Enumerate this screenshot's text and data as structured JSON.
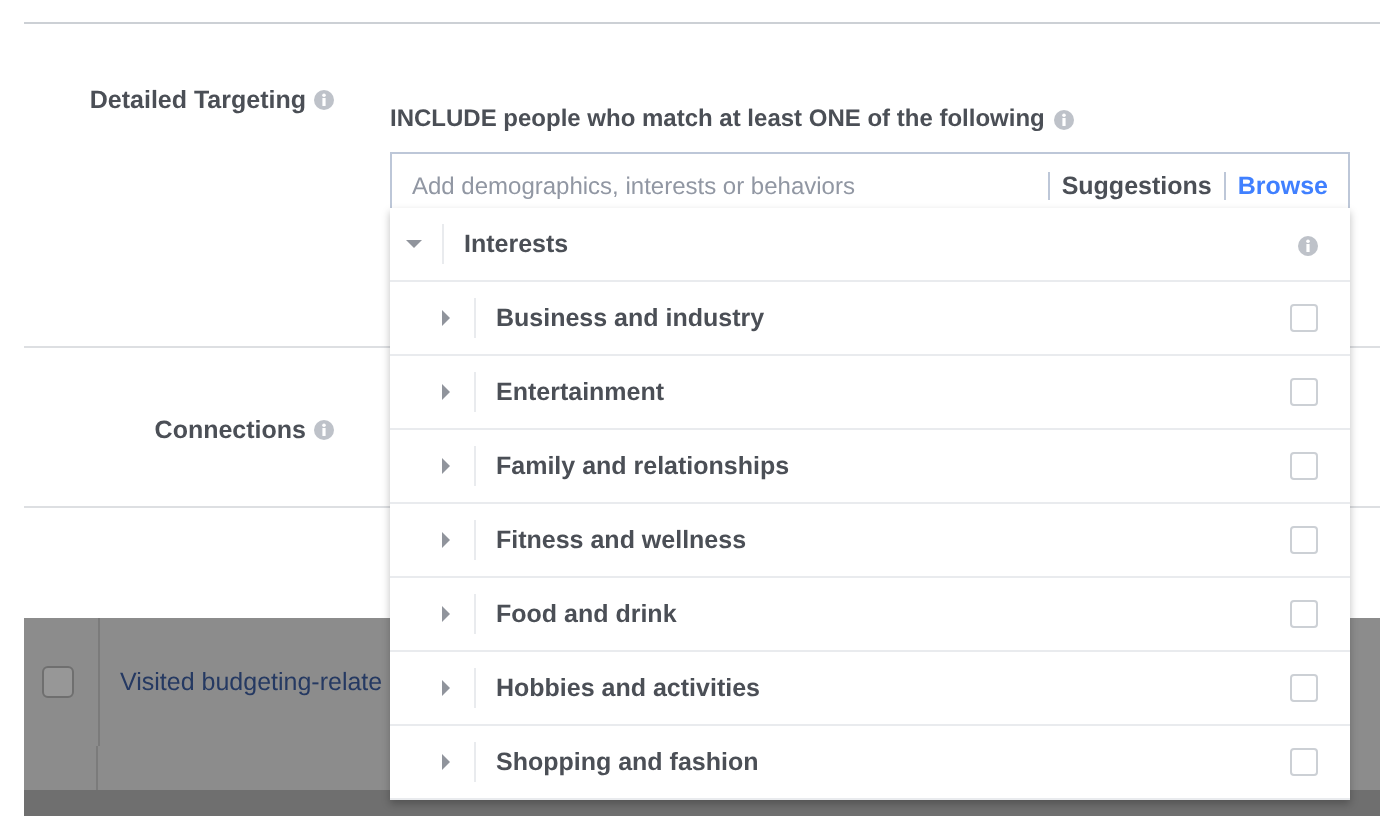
{
  "detailed_targeting": {
    "label": "Detailed Targeting",
    "header": "INCLUDE people who match at least ONE of the following",
    "search": {
      "placeholder": "Add demographics, interests or behaviors"
    },
    "tabs": [
      {
        "label": "Suggestions",
        "selected": false
      },
      {
        "label": "Browse",
        "selected": true
      }
    ],
    "browse": {
      "label": "Interests",
      "expanded": true,
      "children": [
        {
          "label": "Business and industry",
          "expanded": false,
          "checked": false
        },
        {
          "label": "Entertainment",
          "expanded": false,
          "checked": false
        },
        {
          "label": "Family and relationships",
          "expanded": false,
          "checked": false
        },
        {
          "label": "Fitness and wellness",
          "expanded": false,
          "checked": false
        },
        {
          "label": "Food and drink",
          "expanded": false,
          "checked": false
        },
        {
          "label": "Hobbies and activities",
          "expanded": false,
          "checked": false
        },
        {
          "label": "Shopping and fashion",
          "expanded": false,
          "checked": false
        }
      ]
    }
  },
  "connections": {
    "label": "Connections"
  },
  "background_table": {
    "rows": [
      {
        "label": "Visited budgeting-relate",
        "checked": false
      }
    ]
  }
}
